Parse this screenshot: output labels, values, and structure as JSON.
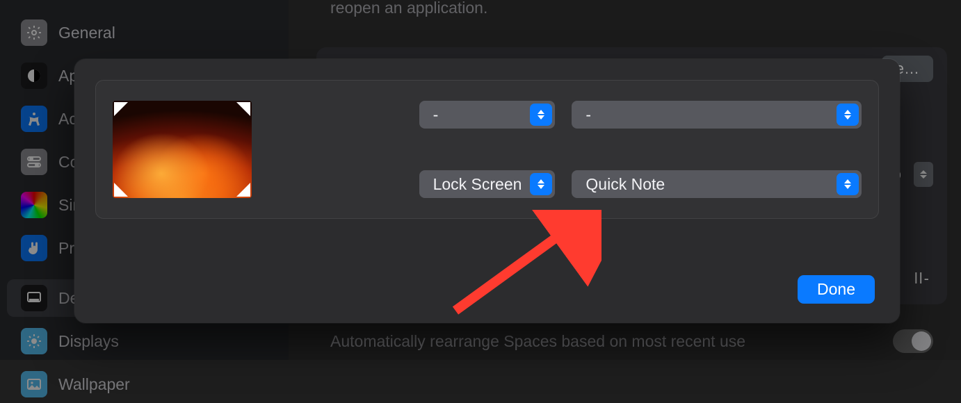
{
  "sidebar": {
    "items": [
      {
        "label": "General"
      },
      {
        "label": "Appearance"
      },
      {
        "label": "Accessibility"
      },
      {
        "label": "Control Center"
      },
      {
        "label": "Siri & Spotlight"
      },
      {
        "label": "Privacy & Security"
      },
      {
        "label": "Desktop & Dock"
      },
      {
        "label": "Displays"
      },
      {
        "label": "Wallpaper"
      }
    ]
  },
  "background": {
    "reopen_text": "reopen an application.",
    "button_e": "e…",
    "stepper_value": "o",
    "ll_dash": "ll-",
    "auto_rearrange": "Automatically rearrange Spaces based on most recent use"
  },
  "modal": {
    "top_left": "-",
    "top_right": "-",
    "bottom_left": "Lock Screen",
    "bottom_right": "Quick Note",
    "done": "Done"
  }
}
